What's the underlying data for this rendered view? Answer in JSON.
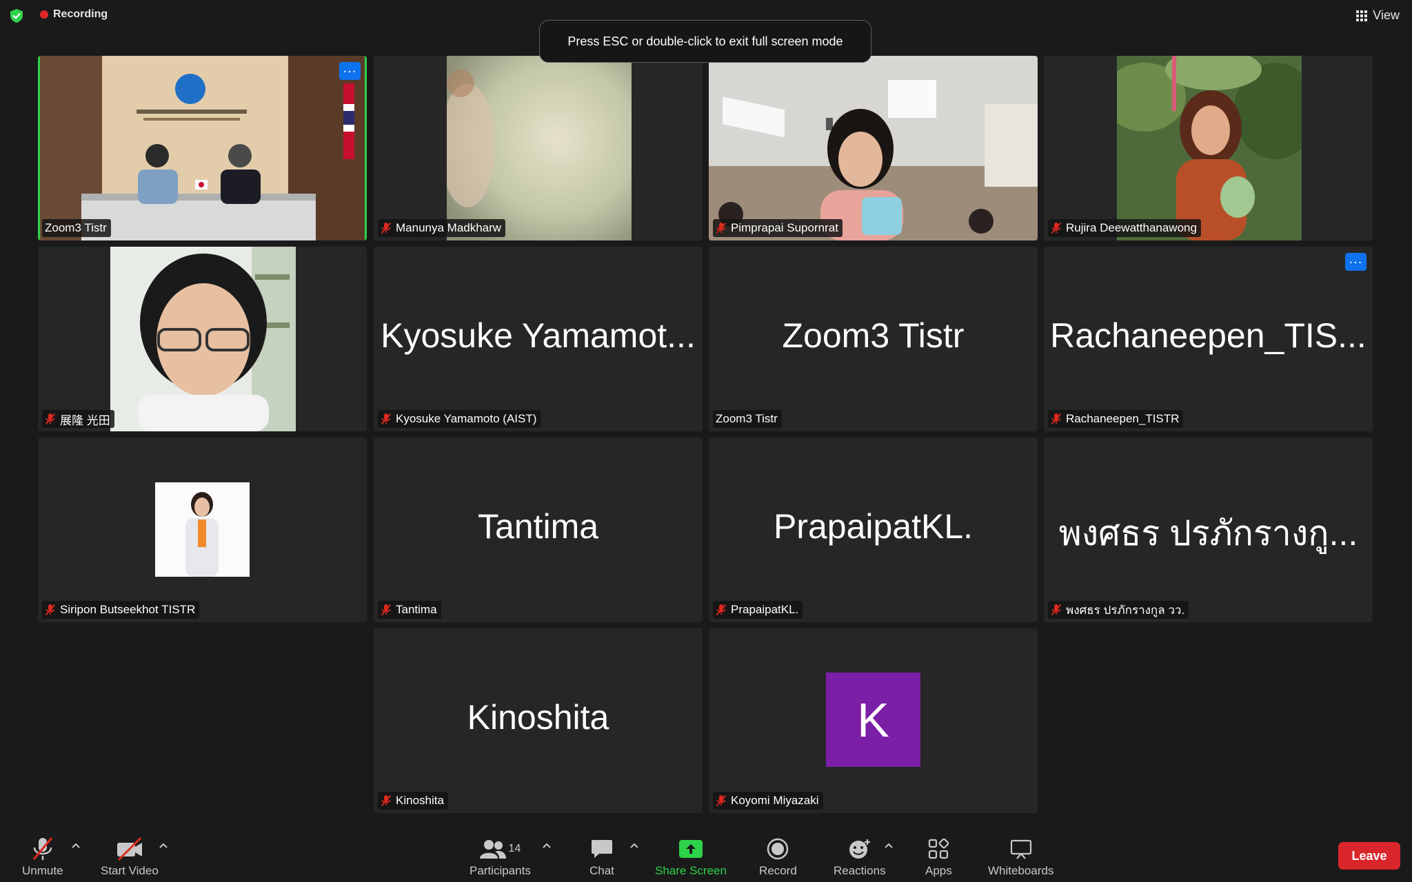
{
  "topbar": {
    "recording_label": "Recording",
    "view_label": "View"
  },
  "toast": "Press ESC or double-click to exit full screen mode",
  "tiles": [
    {
      "name": "Zoom3 Tistr",
      "muted": false
    },
    {
      "name": "Manunya Madkharw",
      "muted": true
    },
    {
      "name": "Pimprapai Supornrat",
      "muted": true
    },
    {
      "name": "Rujira Deewatthanawong",
      "muted": true
    },
    {
      "name": "展隆 光田",
      "muted": true
    },
    {
      "name": "Kyosuke Yamamoto (AIST)",
      "display": "Kyosuke Yamamot...",
      "muted": true
    },
    {
      "name": "Zoom3 Tistr",
      "display": "Zoom3 Tistr",
      "muted": false
    },
    {
      "name": "Rachaneepen_TISTR",
      "display": "Rachaneepen_TIS...",
      "muted": true
    },
    {
      "name": "Siripon Butseekhot TISTR",
      "muted": true
    },
    {
      "name": "Tantima",
      "display": "Tantima",
      "muted": true
    },
    {
      "name": "PrapaipatKL.",
      "display": "PrapaipatKL.",
      "muted": true
    },
    {
      "name": "พงศธร ปรภักรางกูล วว.",
      "display": "พงศธร ปรภักรางกู...",
      "muted": true
    },
    {
      "name": "Kinoshita",
      "display": "Kinoshita",
      "muted": true
    },
    {
      "name": "Koyomi Miyazaki",
      "avatar_letter": "K",
      "muted": true
    }
  ],
  "toolbar": {
    "unmute": "Unmute",
    "start_video": "Start Video",
    "participants": "Participants",
    "participants_count": "14",
    "chat": "Chat",
    "share_screen": "Share Screen",
    "record": "Record",
    "reactions": "Reactions",
    "apps": "Apps",
    "whiteboards": "Whiteboards",
    "leave": "Leave"
  },
  "colors": {
    "active_speaker": "#2ed24a",
    "share_green": "#2ed24a",
    "leave_red": "#d9262b",
    "tile_bg": "#262626",
    "accent_blue": "#0e72ed",
    "avatar_purple": "#7a1fa6"
  }
}
